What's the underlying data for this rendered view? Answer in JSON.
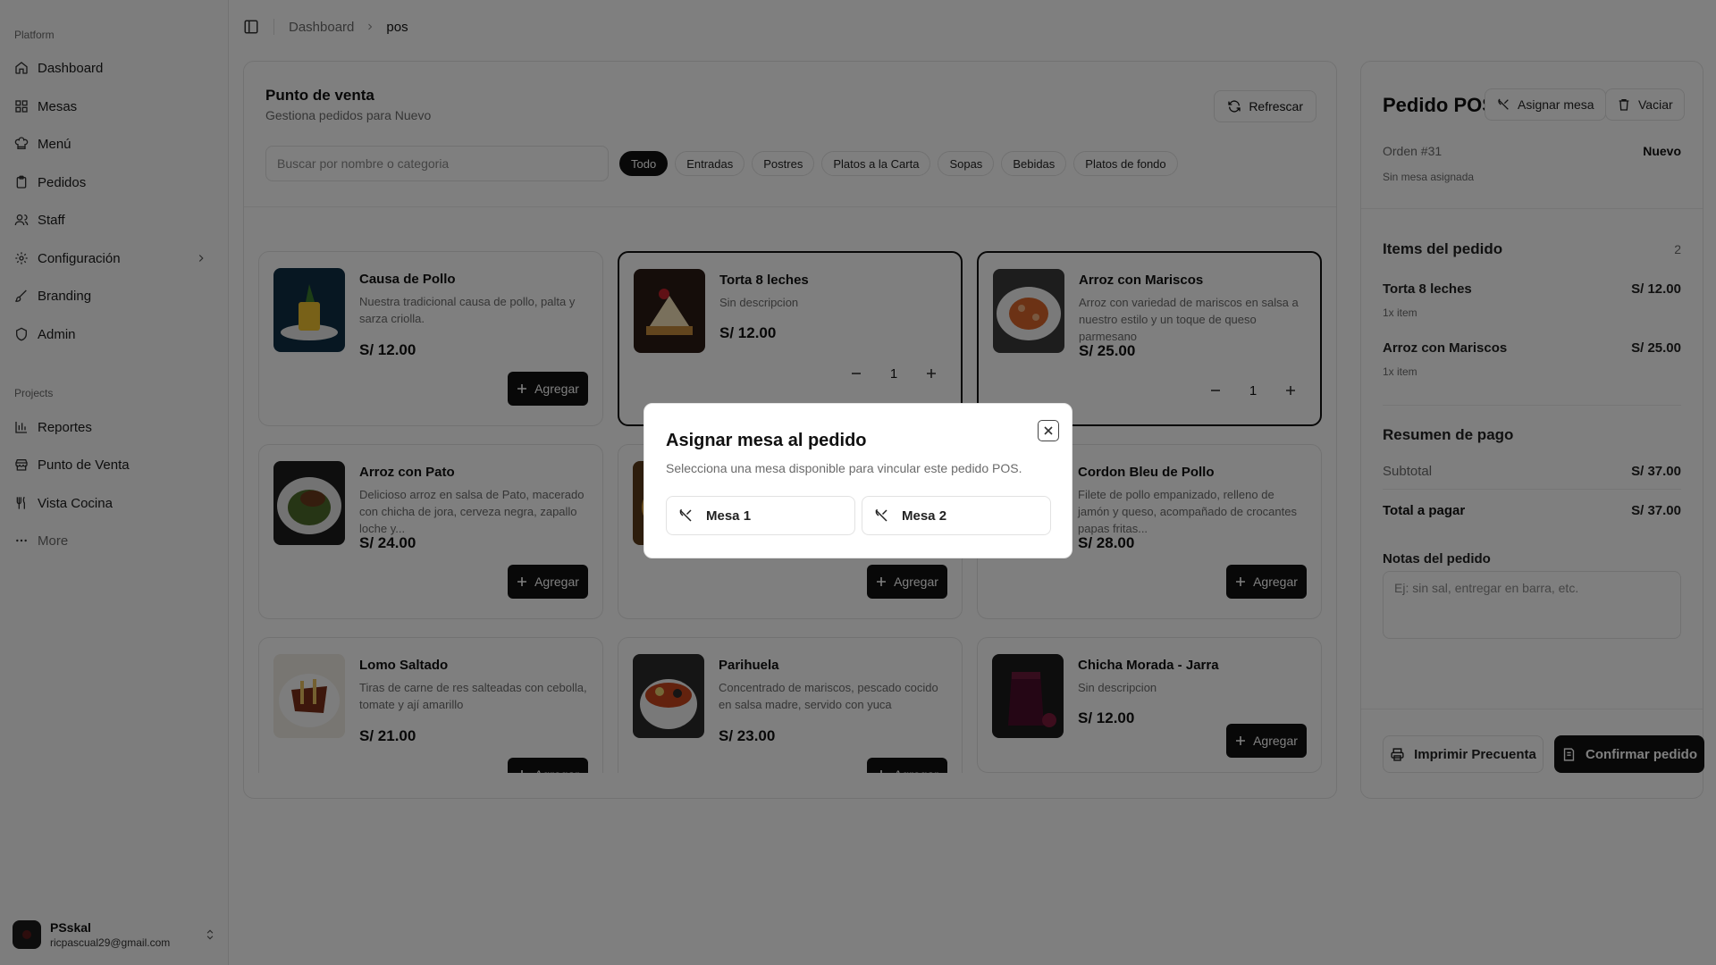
{
  "sidebar": {
    "platform_label": "Platform",
    "platform_items": [
      {
        "label": "Dashboard",
        "icon": "home-icon"
      },
      {
        "label": "Mesas",
        "icon": "grid-icon"
      },
      {
        "label": "Menú",
        "icon": "chef-hat-icon"
      },
      {
        "label": "Pedidos",
        "icon": "clipboard-icon"
      },
      {
        "label": "Staff",
        "icon": "users-icon"
      },
      {
        "label": "Configuración",
        "icon": "gear-icon"
      },
      {
        "label": "Branding",
        "icon": "brush-icon"
      },
      {
        "label": "Admin",
        "icon": "shield-icon"
      }
    ],
    "projects_label": "Projects",
    "project_items": [
      {
        "label": "Reportes",
        "icon": "bar-chart-icon"
      },
      {
        "label": "Punto de Venta",
        "icon": "store-icon"
      },
      {
        "label": "Vista Cocina",
        "icon": "utensils-icon"
      }
    ],
    "more_label": "More",
    "user": {
      "name": "PSskal",
      "email": "ricpascual29@gmail.com"
    }
  },
  "breadcrumb": {
    "items": [
      "Dashboard",
      "pos"
    ]
  },
  "pos": {
    "title": "Punto de venta",
    "subtitle": "Gestiona pedidos para Nuevo",
    "refresh_label": "Refrescar",
    "search_placeholder": "Buscar por nombre o categoria",
    "categories": [
      "Todo",
      "Entradas",
      "Postres",
      "Platos a la Carta",
      "Sopas",
      "Bebidas",
      "Platos de fondo"
    ],
    "active_category": "Todo",
    "add_label": "Agregar",
    "products": [
      {
        "name": "Causa de Pollo",
        "desc": "Nuestra tradicional causa de pollo, palta y sarza criolla.",
        "price": "S/ 12.00"
      },
      {
        "name": "Torta 8 leches",
        "desc": "Sin descripcion",
        "price": "S/ 12.00",
        "qty": "1"
      },
      {
        "name": "Arroz con Mariscos",
        "desc": "Arroz con variedad de mariscos en salsa a nuestro estilo y un toque de queso parmesano",
        "price": "S/ 25.00",
        "qty": "1"
      },
      {
        "name": "Arroz con Pato",
        "desc": "Delicioso arroz en salsa de Pato, macerado con chicha de jora, cerveza negra, zapallo loche y...",
        "price": "S/ 24.00"
      },
      {
        "name": "",
        "desc": "",
        "price": ""
      },
      {
        "name": "Cordon Bleu de Pollo",
        "desc": "Filete de pollo empanizado, relleno de jamón y queso, acompañado de crocantes papas fritas...",
        "price": "S/ 28.00"
      },
      {
        "name": "Lomo Saltado",
        "desc": "Tiras de carne de res salteadas con cebolla, tomate y ají amarillo",
        "price": "S/ 21.00"
      },
      {
        "name": "Parihuela",
        "desc": "Concentrado de mariscos, pescado cocido en salsa madre, servido con yuca",
        "price": "S/ 23.00"
      },
      {
        "name": "Chicha Morada - Jarra",
        "desc": "Sin descripcion",
        "price": "S/ 12.00"
      }
    ]
  },
  "order": {
    "title": "Pedido POS",
    "assign_label": "Asignar mesa",
    "clear_label": "Vaciar",
    "order_number": "Orden #31",
    "status": "Nuevo",
    "table_status": "Sin mesa asignada",
    "items_heading": "Items del pedido",
    "items_count": "2",
    "items": [
      {
        "name": "Torta 8 leches",
        "price": "S/ 12.00",
        "qty": "1x item"
      },
      {
        "name": "Arroz con Mariscos",
        "price": "S/ 25.00",
        "qty": "1x item"
      }
    ],
    "summary_heading": "Resumen de pago",
    "subtotal_label": "Subtotal",
    "subtotal_value": "S/ 37.00",
    "total_label": "Total a pagar",
    "total_value": "S/ 37.00",
    "notes_heading": "Notas del pedido",
    "notes_placeholder": "Ej: sin sal, entregar en barra, etc.",
    "print_label": "Imprimir Precuenta",
    "confirm_label": "Confirmar pedido"
  },
  "dialog": {
    "title": "Asignar mesa al pedido",
    "description": "Selecciona una mesa disponible para vincular este pedido POS.",
    "tables": [
      "Mesa 1",
      "Mesa 2"
    ]
  }
}
